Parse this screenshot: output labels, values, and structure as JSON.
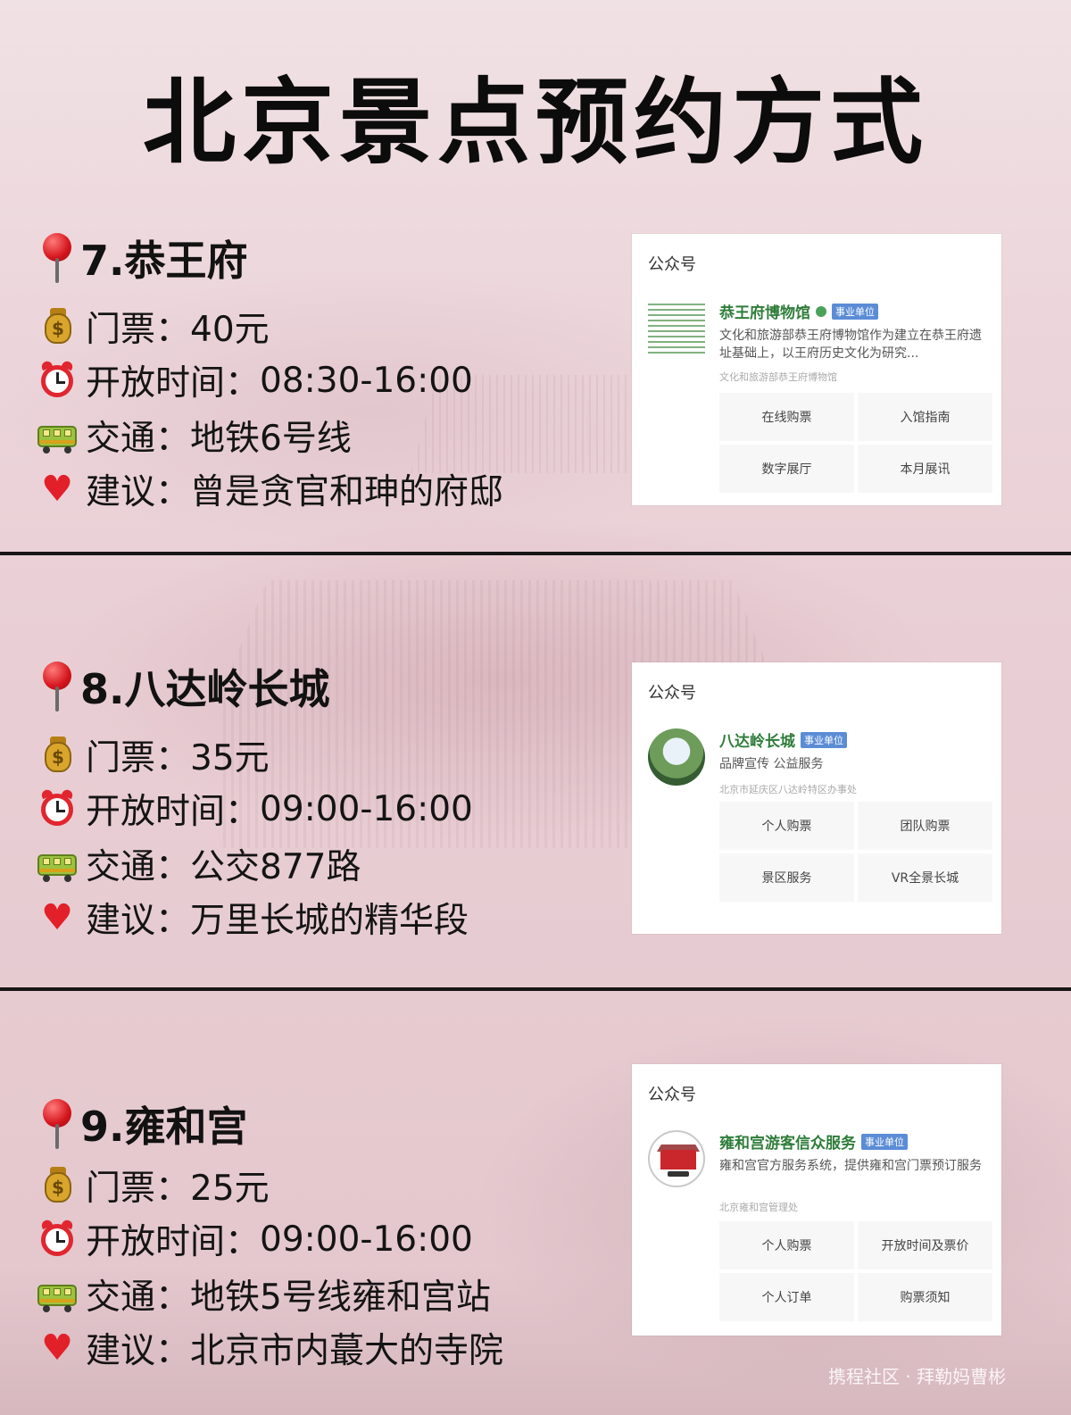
{
  "title": "北京景点预约方式",
  "sections": [
    {
      "heading": "7.恭王府",
      "ticket_label": "门票：",
      "ticket": "40元",
      "hours_label": "开放时间：",
      "hours": "08:30-16:00",
      "transit_label": "交通：",
      "transit": "地铁6号线",
      "tip_label": "建议：",
      "tip": "曾是贪官和珅的府邸",
      "card": {
        "category": "公众号",
        "name": "恭王府博物馆",
        "tag": "事业单位",
        "desc": "文化和旅游部恭王府博物馆作为建立在恭王府遗址基础上，以王府历史文化为研究...",
        "owner": "文化和旅游部恭王府博物馆",
        "menu": [
          "在线购票",
          "入馆指南",
          "数字展厅",
          "本月展讯"
        ]
      }
    },
    {
      "heading": "8.八达岭长城",
      "ticket_label": "门票：",
      "ticket": "35元",
      "hours_label": "开放时间：",
      "hours": "09:00-16:00",
      "transit_label": "交通：",
      "transit": "公交877路",
      "tip_label": "建议：",
      "tip": "万里长城的精华段",
      "card": {
        "category": "公众号",
        "name": "八达岭长城",
        "tag": "事业单位",
        "desc": "品牌宣传 公益服务",
        "owner": "北京市延庆区八达岭特区办事处",
        "menu": [
          "个人购票",
          "团队购票",
          "景区服务",
          "VR全景长城"
        ]
      }
    },
    {
      "heading": "9.雍和宫",
      "ticket_label": "门票：",
      "ticket": "25元",
      "hours_label": "开放时间：",
      "hours": "09:00-16:00",
      "transit_label": "交通：",
      "transit": "地铁5号线雍和宫站",
      "tip_label": "建议：",
      "tip": "北京市内蕞大的寺院",
      "card": {
        "category": "公众号",
        "name": "雍和宫游客信众服务",
        "tag": "事业单位",
        "desc": "雍和宫官方服务系统，提供雍和宫门票预订服务",
        "owner": "北京雍和宫管理处",
        "menu": [
          "个人购票",
          "开放时间及票价",
          "个人订单",
          "购票须知"
        ]
      }
    }
  ],
  "watermark": "携程社区 · 拜勒妈曹彬",
  "colors": {
    "title": "#0c0c0c",
    "divider": "#161616",
    "card_name": "#2f7d3a",
    "tag": "#5b8cd6",
    "pin": "#d4141c",
    "heart": "#e2202a"
  },
  "icons": [
    "pin-icon",
    "money-bag-icon",
    "alarm-clock-icon",
    "tram-icon",
    "heart-icon"
  ]
}
